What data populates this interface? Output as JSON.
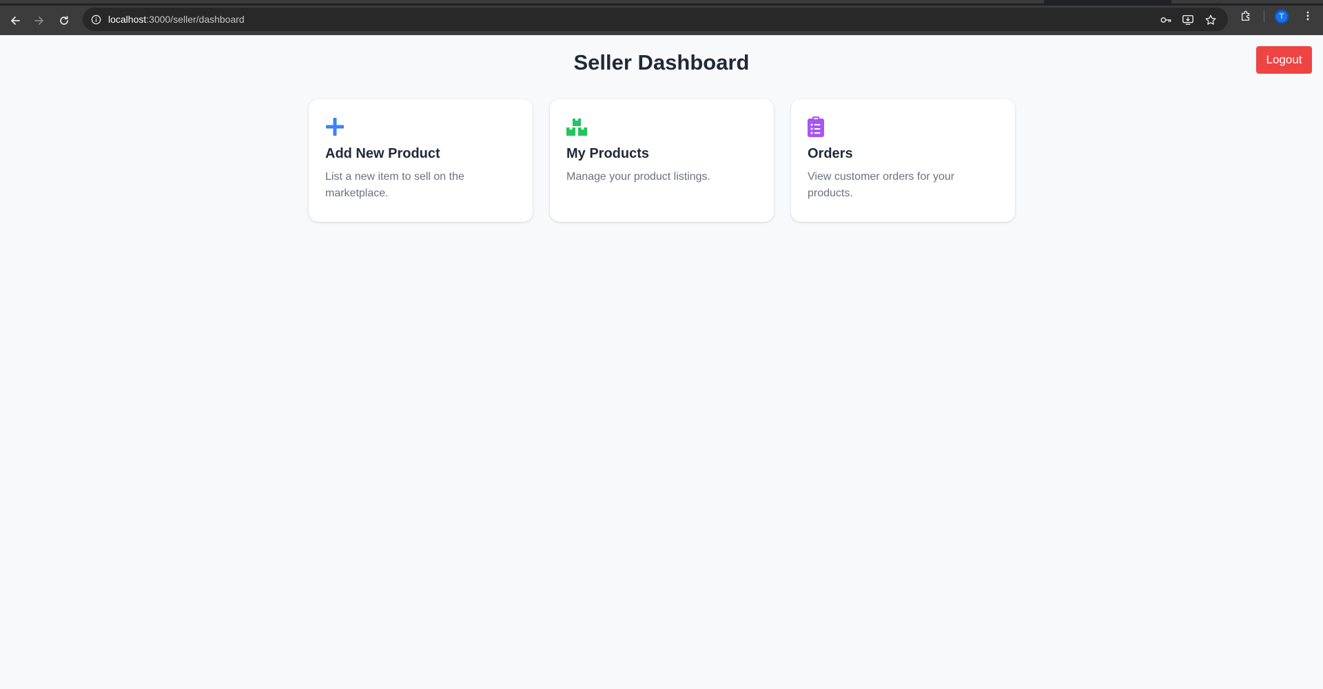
{
  "browser": {
    "url_host": "localhost",
    "url_path": ":3000/seller/dashboard",
    "profile_initial": "T"
  },
  "page": {
    "title": "Seller Dashboard",
    "logout_label": "Logout"
  },
  "cards": [
    {
      "icon": "plus-icon",
      "title": "Add New Product",
      "description": "List a new item to sell on the marketplace."
    },
    {
      "icon": "boxes-icon",
      "title": "My Products",
      "description": "Manage your product listings."
    },
    {
      "icon": "clipboard-list-icon",
      "title": "Orders",
      "description": "View customer orders for your products."
    }
  ],
  "colors": {
    "logout_bg": "#ef4444",
    "add_icon": "#3b82f6",
    "products_icon": "#22c55e",
    "orders_icon": "#a855f7"
  }
}
